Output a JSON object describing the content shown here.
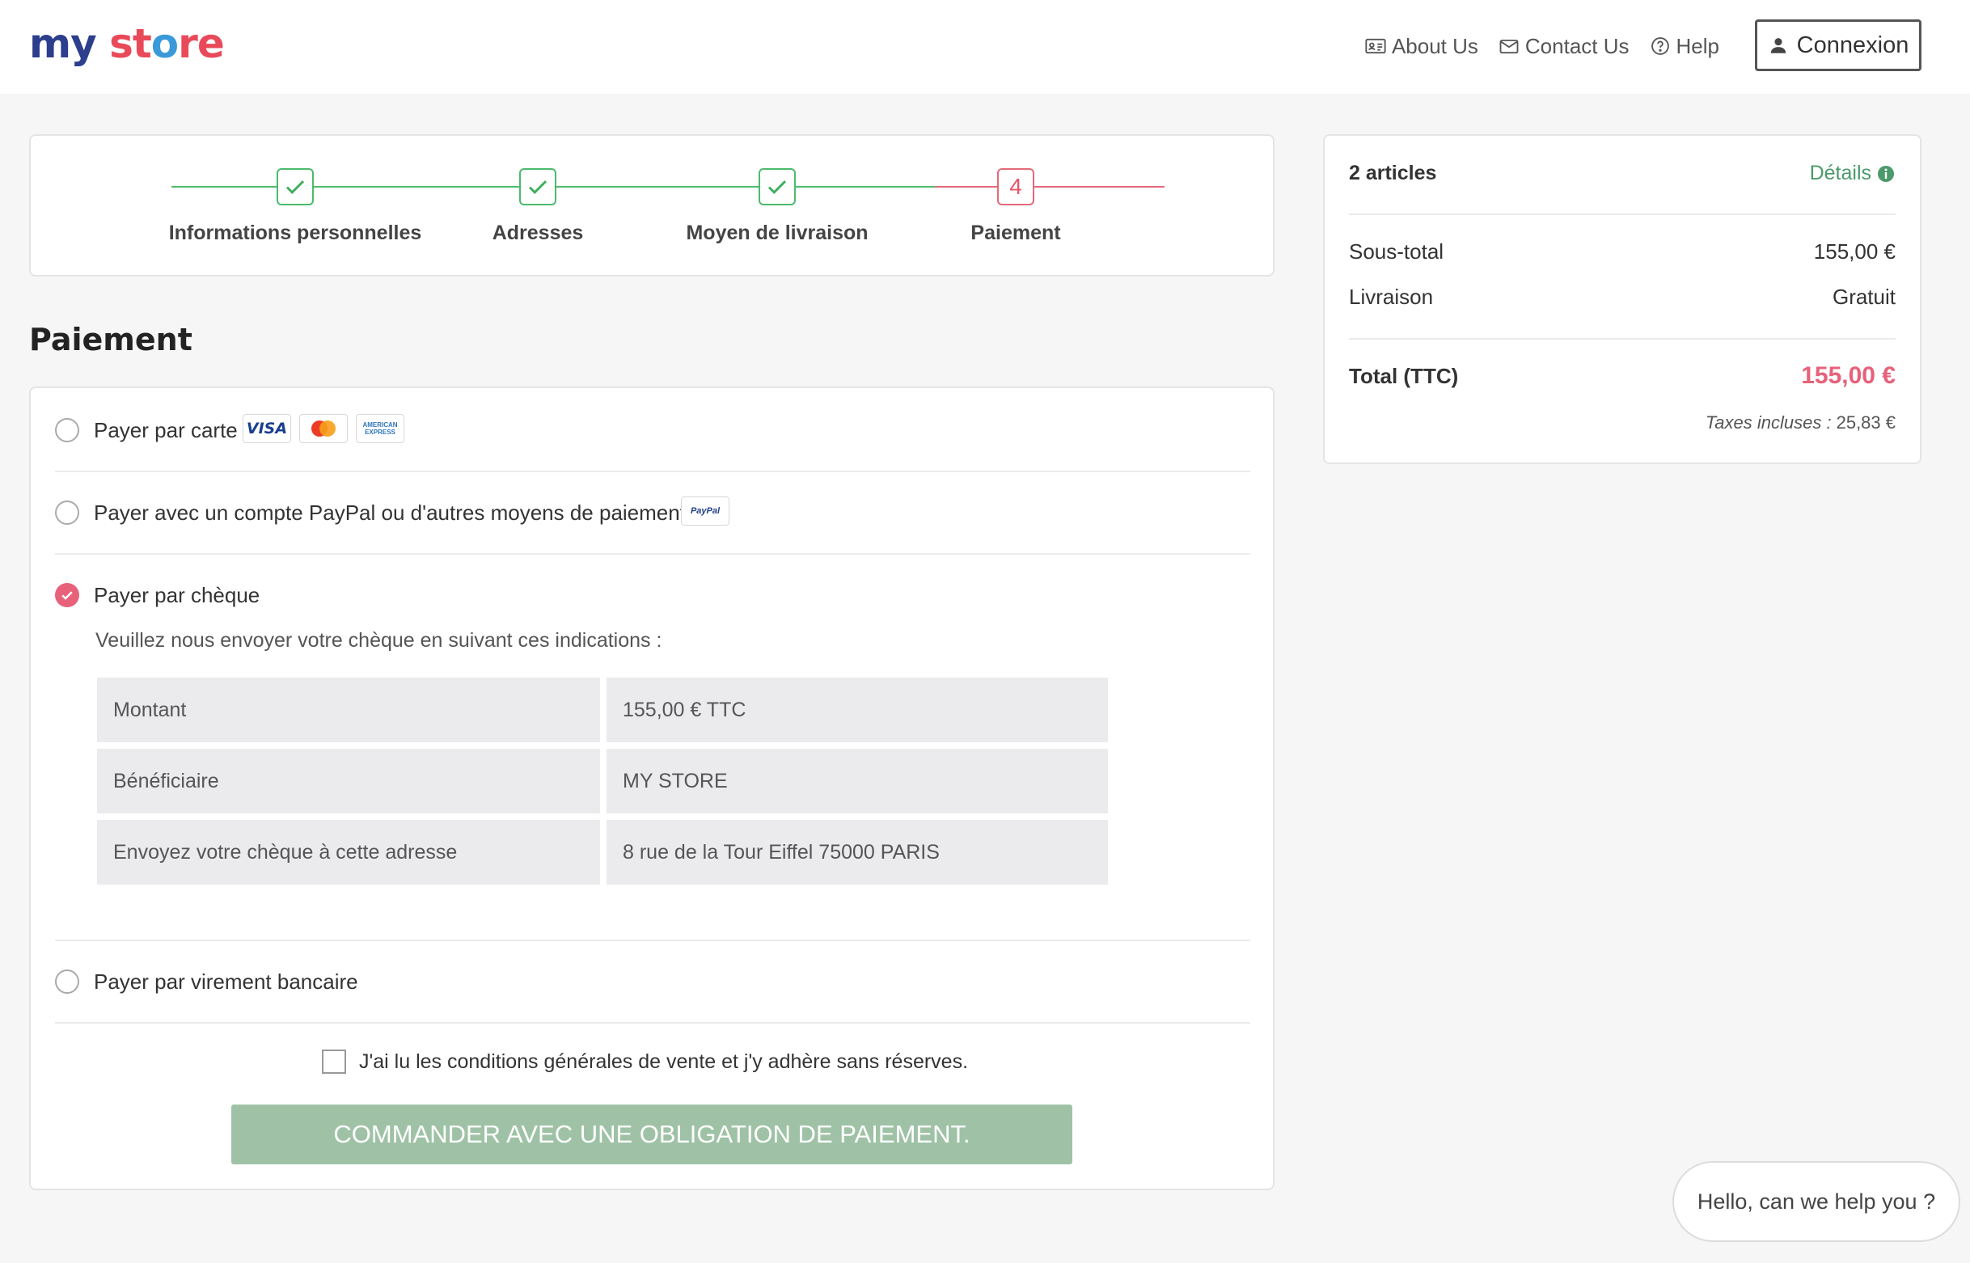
{
  "header": {
    "logo": {
      "part1": "my",
      "part2": "st",
      "part3": "o",
      "part4": "re"
    },
    "nav": [
      {
        "label": "About Us",
        "icon": "id-card-icon"
      },
      {
        "label": "Contact Us",
        "icon": "envelope-icon"
      },
      {
        "label": "Help",
        "icon": "help-circle-icon"
      }
    ],
    "login_label": "Connexion"
  },
  "steps": [
    {
      "label": "Informations personnelles",
      "status": "done"
    },
    {
      "label": "Adresses",
      "status": "done"
    },
    {
      "label": "Moyen de livraison",
      "status": "done"
    },
    {
      "label": "Paiement",
      "status": "current",
      "number": "4"
    }
  ],
  "page_title": "Paiement",
  "payment": {
    "options": [
      {
        "label": "Payer par carte",
        "checked": false,
        "logos": [
          "VISA",
          "mastercard",
          "AMERICAN EXPRESS"
        ]
      },
      {
        "label": "Payer avec un compte PayPal ou d'autres moyens de paiement",
        "checked": false,
        "logos": [
          "PayPal"
        ]
      },
      {
        "label": "Payer par chèque",
        "checked": true
      },
      {
        "label": "Payer par virement bancaire",
        "checked": false
      }
    ],
    "cheque_instructions": "Veuillez nous envoyer votre chèque en suivant ces indications :",
    "cheque_table": [
      {
        "key": "Montant",
        "value": "155,00 € TTC"
      },
      {
        "key": "Bénéficiaire",
        "value": "MY STORE"
      },
      {
        "key": "Envoyez votre chèque à cette adresse",
        "value": "8 rue de la Tour Eiffel 75000 PARIS"
      }
    ],
    "terms_label": "J'ai lu les conditions générales de vente et j'y adhère sans réserves.",
    "order_button": "COMMANDER AVEC UNE OBLIGATION DE PAIEMENT."
  },
  "summary": {
    "count": "2 articles",
    "details_label": "Détails",
    "subtotal_label": "Sous-total",
    "subtotal_value": "155,00 €",
    "shipping_label": "Livraison",
    "shipping_value": "Gratuit",
    "total_label": "Total (TTC)",
    "total_value": "155,00 €",
    "taxes_label": "Taxes incluses :",
    "taxes_value": "25,83 €"
  },
  "chat": "Hello, can we help you ?",
  "colors": {
    "accent": "#e8617a",
    "success": "#4cbb6c",
    "button": "#9fc2a6",
    "details": "#4b9a6b"
  }
}
